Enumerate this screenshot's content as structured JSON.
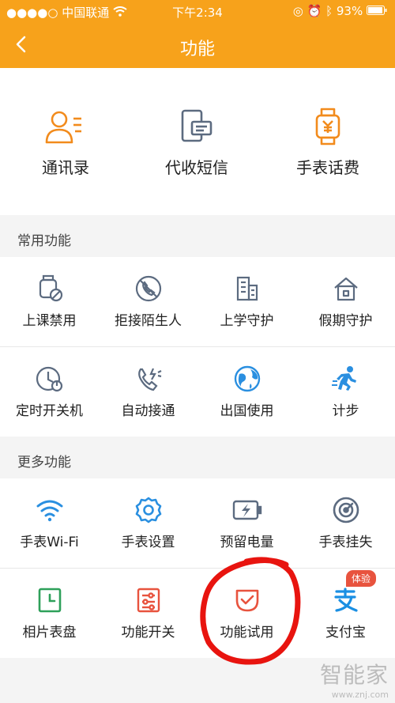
{
  "status": {
    "carrier": "中国联通",
    "time": "下午2:34",
    "battery": "93%"
  },
  "nav": {
    "title": "功能"
  },
  "top": [
    {
      "label": "通讯录"
    },
    {
      "label": "代收短信"
    },
    {
      "label": "手表话费"
    }
  ],
  "sections": {
    "common": {
      "title": "常用功能",
      "row1": [
        "上课禁用",
        "拒接陌生人",
        "上学守护",
        "假期守护"
      ],
      "row2": [
        "定时开关机",
        "自动接通",
        "出国使用",
        "计步"
      ]
    },
    "more": {
      "title": "更多功能",
      "row1": [
        "手表Wi-Fi",
        "手表设置",
        "预留电量",
        "手表挂失"
      ],
      "row2": [
        "相片表盘",
        "功能开关",
        "功能试用",
        "支付宝"
      ]
    }
  },
  "badge": "体验",
  "watermark": {
    "main": "智能家",
    "sub": "www.znj.com"
  },
  "colors": {
    "accent": "#f7a21b",
    "blue": "#2a8fe0",
    "green": "#2ea05a",
    "red": "#e8533e"
  }
}
